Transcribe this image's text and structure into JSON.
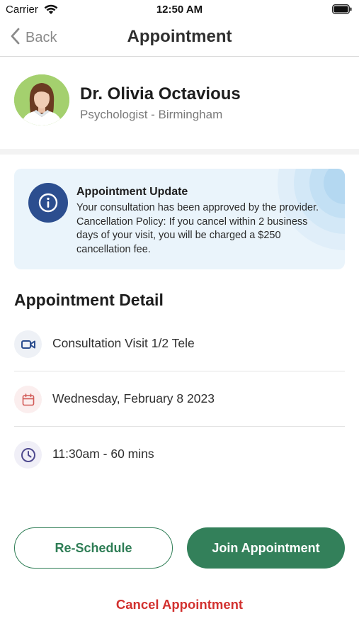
{
  "status_bar": {
    "carrier": "Carrier",
    "time": "12:50 AM",
    "wifi_icon": "wifi-icon",
    "battery_icon": "battery-icon"
  },
  "nav": {
    "back_label": "Back",
    "title": "Appointment",
    "back_icon": "chevron-left-icon"
  },
  "doctor": {
    "name": "Dr. Olivia Octavious",
    "role": "Psychologist - Birmingham"
  },
  "alert": {
    "icon": "info-icon",
    "title": "Appointment Update",
    "body": "Your consultation has been approved by the provider. Cancellation Policy: If you cancel within 2 business days of your visit, you will be charged a $250 cancellation fee."
  },
  "details": {
    "heading": "Appointment Detail",
    "items": [
      {
        "icon": "video-camera-icon",
        "label": "Consultation Visit 1/2 Tele"
      },
      {
        "icon": "calendar-icon",
        "label": "Wednesday, February 8 2023"
      },
      {
        "icon": "clock-icon",
        "label": "11:30am - 60 mins"
      }
    ]
  },
  "actions": {
    "reschedule_label": "Re-Schedule",
    "join_label": "Join Appointment",
    "cancel_label": "Cancel Appointment"
  },
  "colors": {
    "primary_green": "#33805a",
    "cancel_red": "#d2312f",
    "info_blue": "#2c4e8f",
    "alert_bg": "#eaf4fb"
  }
}
